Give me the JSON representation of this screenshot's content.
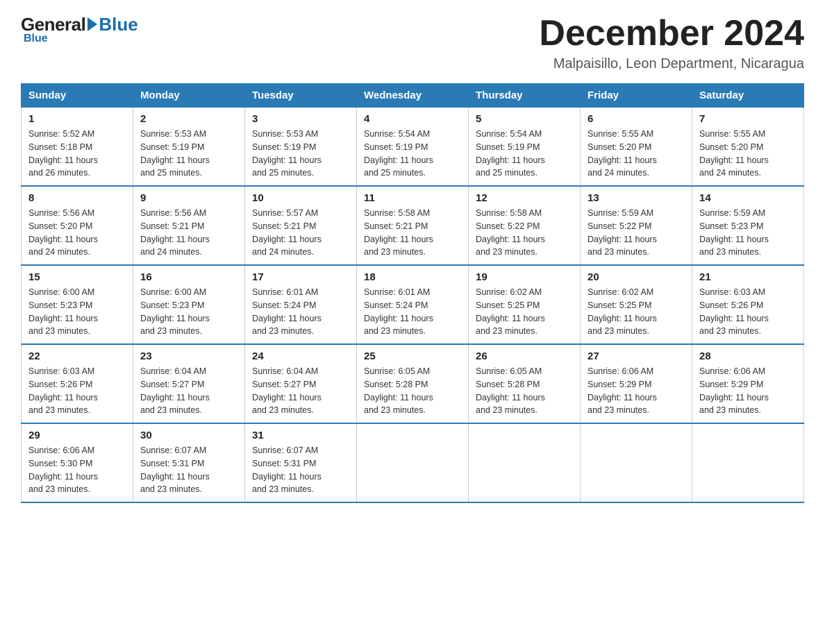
{
  "logo": {
    "general": "General",
    "blue": "Blue"
  },
  "title": {
    "month": "December 2024",
    "location": "Malpaisillo, Leon Department, Nicaragua"
  },
  "weekdays": [
    "Sunday",
    "Monday",
    "Tuesday",
    "Wednesday",
    "Thursday",
    "Friday",
    "Saturday"
  ],
  "weeks": [
    [
      {
        "day": "1",
        "sunrise": "5:52 AM",
        "sunset": "5:18 PM",
        "daylight": "11 hours and 26 minutes."
      },
      {
        "day": "2",
        "sunrise": "5:53 AM",
        "sunset": "5:19 PM",
        "daylight": "11 hours and 25 minutes."
      },
      {
        "day": "3",
        "sunrise": "5:53 AM",
        "sunset": "5:19 PM",
        "daylight": "11 hours and 25 minutes."
      },
      {
        "day": "4",
        "sunrise": "5:54 AM",
        "sunset": "5:19 PM",
        "daylight": "11 hours and 25 minutes."
      },
      {
        "day": "5",
        "sunrise": "5:54 AM",
        "sunset": "5:19 PM",
        "daylight": "11 hours and 25 minutes."
      },
      {
        "day": "6",
        "sunrise": "5:55 AM",
        "sunset": "5:20 PM",
        "daylight": "11 hours and 24 minutes."
      },
      {
        "day": "7",
        "sunrise": "5:55 AM",
        "sunset": "5:20 PM",
        "daylight": "11 hours and 24 minutes."
      }
    ],
    [
      {
        "day": "8",
        "sunrise": "5:56 AM",
        "sunset": "5:20 PM",
        "daylight": "11 hours and 24 minutes."
      },
      {
        "day": "9",
        "sunrise": "5:56 AM",
        "sunset": "5:21 PM",
        "daylight": "11 hours and 24 minutes."
      },
      {
        "day": "10",
        "sunrise": "5:57 AM",
        "sunset": "5:21 PM",
        "daylight": "11 hours and 24 minutes."
      },
      {
        "day": "11",
        "sunrise": "5:58 AM",
        "sunset": "5:21 PM",
        "daylight": "11 hours and 23 minutes."
      },
      {
        "day": "12",
        "sunrise": "5:58 AM",
        "sunset": "5:22 PM",
        "daylight": "11 hours and 23 minutes."
      },
      {
        "day": "13",
        "sunrise": "5:59 AM",
        "sunset": "5:22 PM",
        "daylight": "11 hours and 23 minutes."
      },
      {
        "day": "14",
        "sunrise": "5:59 AM",
        "sunset": "5:23 PM",
        "daylight": "11 hours and 23 minutes."
      }
    ],
    [
      {
        "day": "15",
        "sunrise": "6:00 AM",
        "sunset": "5:23 PM",
        "daylight": "11 hours and 23 minutes."
      },
      {
        "day": "16",
        "sunrise": "6:00 AM",
        "sunset": "5:23 PM",
        "daylight": "11 hours and 23 minutes."
      },
      {
        "day": "17",
        "sunrise": "6:01 AM",
        "sunset": "5:24 PM",
        "daylight": "11 hours and 23 minutes."
      },
      {
        "day": "18",
        "sunrise": "6:01 AM",
        "sunset": "5:24 PM",
        "daylight": "11 hours and 23 minutes."
      },
      {
        "day": "19",
        "sunrise": "6:02 AM",
        "sunset": "5:25 PM",
        "daylight": "11 hours and 23 minutes."
      },
      {
        "day": "20",
        "sunrise": "6:02 AM",
        "sunset": "5:25 PM",
        "daylight": "11 hours and 23 minutes."
      },
      {
        "day": "21",
        "sunrise": "6:03 AM",
        "sunset": "5:26 PM",
        "daylight": "11 hours and 23 minutes."
      }
    ],
    [
      {
        "day": "22",
        "sunrise": "6:03 AM",
        "sunset": "5:26 PM",
        "daylight": "11 hours and 23 minutes."
      },
      {
        "day": "23",
        "sunrise": "6:04 AM",
        "sunset": "5:27 PM",
        "daylight": "11 hours and 23 minutes."
      },
      {
        "day": "24",
        "sunrise": "6:04 AM",
        "sunset": "5:27 PM",
        "daylight": "11 hours and 23 minutes."
      },
      {
        "day": "25",
        "sunrise": "6:05 AM",
        "sunset": "5:28 PM",
        "daylight": "11 hours and 23 minutes."
      },
      {
        "day": "26",
        "sunrise": "6:05 AM",
        "sunset": "5:28 PM",
        "daylight": "11 hours and 23 minutes."
      },
      {
        "day": "27",
        "sunrise": "6:06 AM",
        "sunset": "5:29 PM",
        "daylight": "11 hours and 23 minutes."
      },
      {
        "day": "28",
        "sunrise": "6:06 AM",
        "sunset": "5:29 PM",
        "daylight": "11 hours and 23 minutes."
      }
    ],
    [
      {
        "day": "29",
        "sunrise": "6:06 AM",
        "sunset": "5:30 PM",
        "daylight": "11 hours and 23 minutes."
      },
      {
        "day": "30",
        "sunrise": "6:07 AM",
        "sunset": "5:31 PM",
        "daylight": "11 hours and 23 minutes."
      },
      {
        "day": "31",
        "sunrise": "6:07 AM",
        "sunset": "5:31 PM",
        "daylight": "11 hours and 23 minutes."
      },
      null,
      null,
      null,
      null
    ]
  ],
  "labels": {
    "sunrise": "Sunrise:",
    "sunset": "Sunset:",
    "daylight": "Daylight:"
  }
}
